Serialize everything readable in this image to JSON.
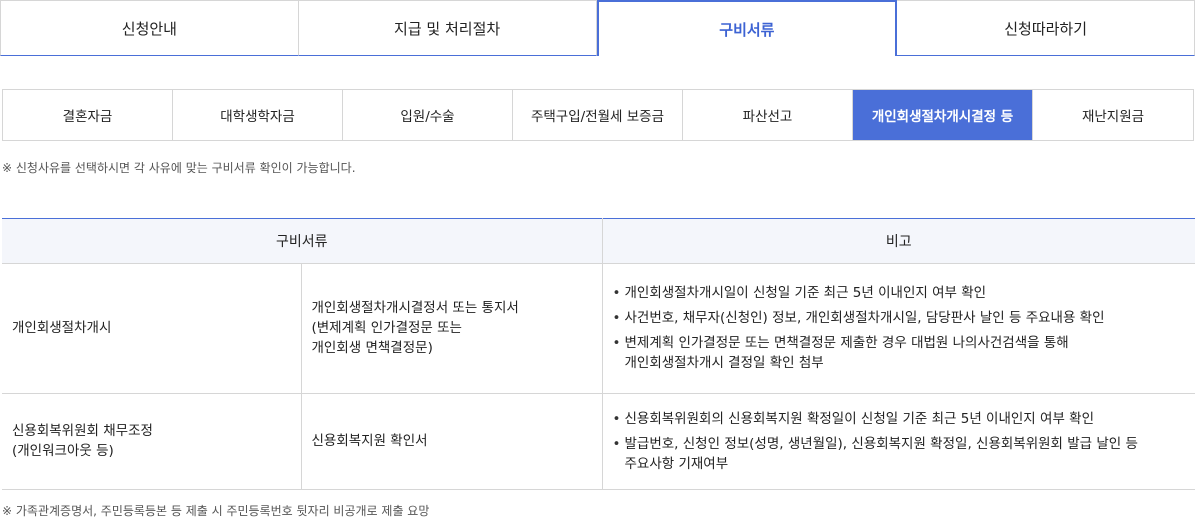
{
  "top_tabs": [
    "신청안내",
    "지급 및 처리절차",
    "구비서류",
    "신청따라하기"
  ],
  "active_top_tab": 2,
  "sub_tabs": [
    "결혼자금",
    "대학생학자금",
    "입원/수술",
    "주택구입/전월세 보증금",
    "파산선고",
    "개인회생절차개시결정 등",
    "재난지원금"
  ],
  "active_sub_tab": 5,
  "note_top": "※ 신청사유를 선택하시면 각 사유에 맞는 구비서류 확인이 가능합니다.",
  "table": {
    "headers": [
      "구비서류",
      "비고"
    ],
    "rows": [
      {
        "category": "개인회생절차개시",
        "document": "개인회생절차개시결정서 또는 통지서\n(변제계획 인가결정문 또는\n개인회생 면책결정문)",
        "notes": [
          "개인회생절차개시일이 신청일 기준 최근 5년 이내인지 여부 확인",
          "사건번호, 채무자(신청인) 정보, 개인회생절차개시일, 담당판사 날인 등 주요내용 확인",
          "변제계획 인가결정문 또는 면책결정문 제출한 경우 대법원 나의사건검색을 통해\n개인회생절차개시 결정일 확인 첨부"
        ]
      },
      {
        "category": "신용회복위원회 채무조정\n(개인워크아웃 등)",
        "document": "신용회복지원 확인서",
        "notes": [
          "신용회복위원회의 신용회복지원 확정일이 신청일 기준 최근 5년 이내인지 여부 확인",
          "발급번호, 신청인 정보(성명, 생년월일), 신용회복지원 확정일, 신용회복위원회 발급 날인 등\n주요사항 기재여부"
        ]
      }
    ]
  },
  "note_bottom": "※ 가족관계증명서, 주민등록등본 등 제출 시 주민등록번호 뒷자리 비공개로 제출 요망",
  "colors": {
    "accent": "#4a6fd8",
    "header_bg": "#f4f6fb",
    "border": "#d6d6d6"
  }
}
